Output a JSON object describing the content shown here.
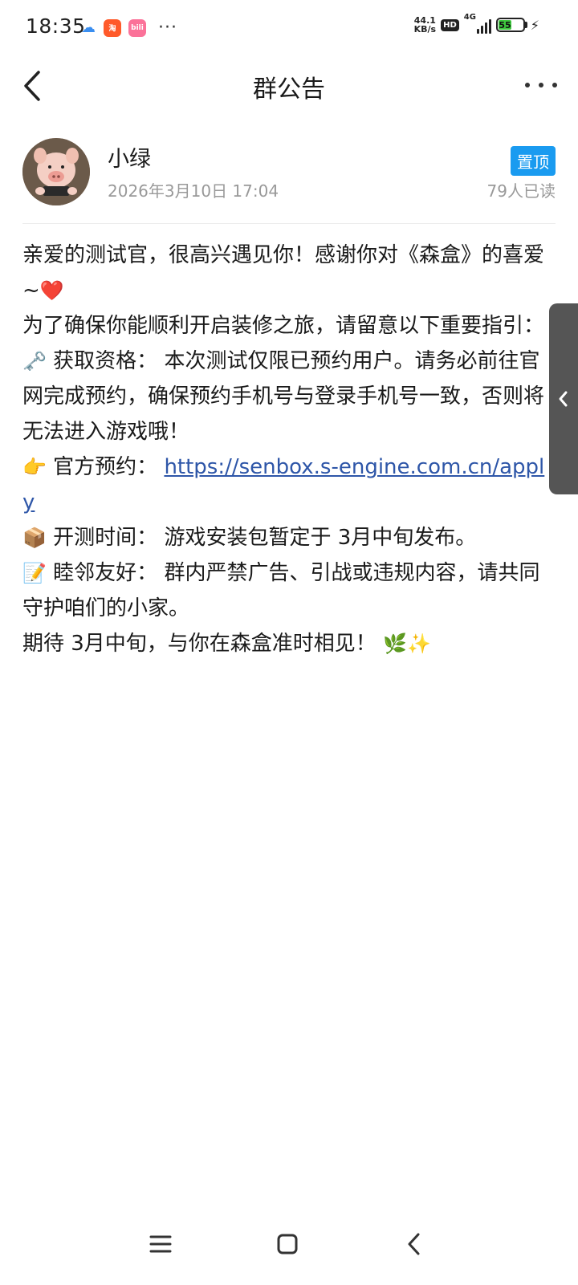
{
  "status_bar": {
    "time": "18:35",
    "netspeed_value": "44.1",
    "netspeed_unit": "KB/s",
    "hd": "HD",
    "network": "4G",
    "battery": "55",
    "more": "···",
    "app_icons": [
      "baidu-cloud-icon",
      "taobao-icon",
      "bilibili-icon"
    ]
  },
  "header": {
    "title": "群公告"
  },
  "author": {
    "name": "小绿",
    "time": "2026年3月10日 17:04",
    "pin_label": "置顶",
    "read_count": "79人已读"
  },
  "content": {
    "line1": "亲爱的测试官，很高兴遇见你！感谢你对《森盒》的喜爱~",
    "line1_emoji": "❤️",
    "line2": "为了确保你能顺利开启装修之旅，请留意以下重要指引：",
    "item1_emoji": "🗝️",
    "item1_label": "获取资格：",
    "item1_text": "本次测试仅限已预约用户。请务必前往官网完成预约，确保预约手机号与登录手机号一致，否则将无法进入游戏哦！",
    "item2_emoji": "👉",
    "item2_label": "官方预约：",
    "item2_link": "https://senbox.s-engine.com.cn/apply",
    "item3_emoji": "📦",
    "item3_label": "开测时间：",
    "item3_text": "游戏安装包暂定于 3月中旬发布。",
    "item4_emoji": "📝",
    "item4_label": "睦邻友好：",
    "item4_text": "群内严禁广告、引战或违规内容，请共同守护咱们的小家。",
    "closing": "期待 3月中旬，与你在森盒准时相见！",
    "closing_emoji": "🌿✨"
  },
  "colors": {
    "pin_badge": "#1a9bf0",
    "link": "#2e56a8",
    "meta_text": "#999999",
    "battery": "#3ec93e"
  }
}
